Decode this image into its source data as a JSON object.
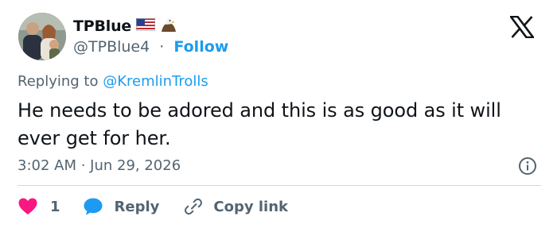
{
  "author": {
    "display_name": "TPBlue",
    "handle": "@TPBlue4",
    "separator": "·",
    "follow_label": "Follow"
  },
  "reply_context": {
    "prefix": "Replying to ",
    "target": "@KremlinTrolls"
  },
  "tweet": {
    "text": "He needs to be adored and this is as good as it will ever get for her.",
    "timestamp": "3:02 AM · Jun 29, 2026"
  },
  "actions": {
    "like_count": "1",
    "reply_label": "Reply",
    "copy_label": "Copy link"
  },
  "icons": {
    "brand": "x-logo-icon",
    "info": "info-icon",
    "like": "heart-icon",
    "reply": "speech-bubble-icon",
    "copy": "link-icon"
  },
  "colors": {
    "link": "#1d9bf0",
    "like": "#f91880",
    "muted": "#536471",
    "text": "#0f1419"
  }
}
